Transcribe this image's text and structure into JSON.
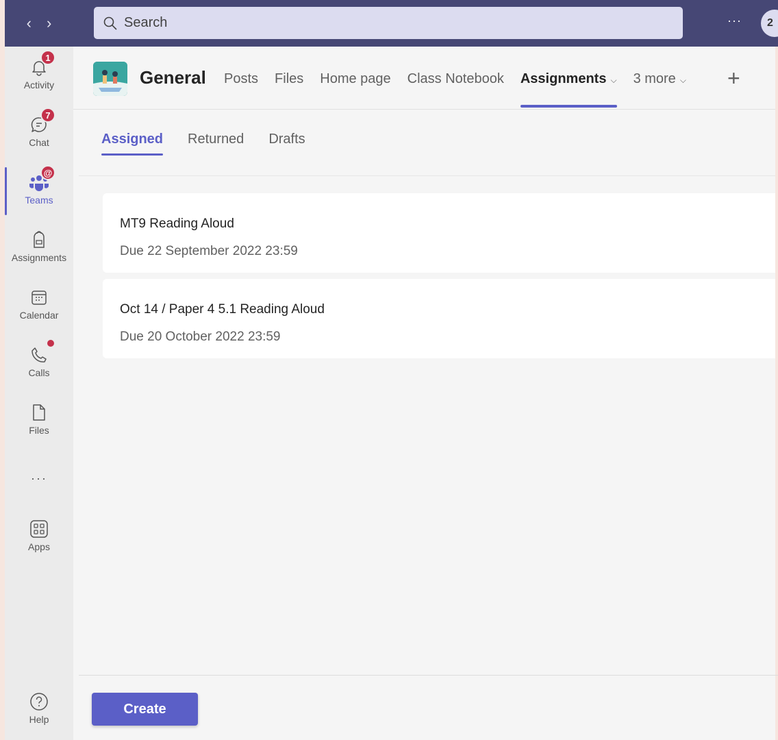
{
  "topbar": {
    "search_placeholder": "Search",
    "more_label": "···",
    "avatar_initials": "2"
  },
  "rail": {
    "items": [
      {
        "label": "Activity",
        "badge": "1"
      },
      {
        "label": "Chat",
        "badge": "7"
      },
      {
        "label": "Teams",
        "badge": "@"
      },
      {
        "label": "Assignments"
      },
      {
        "label": "Calendar"
      },
      {
        "label": "Calls"
      },
      {
        "label": "Files"
      },
      {
        "label": "Apps"
      },
      {
        "label": "Help"
      }
    ],
    "more_label": "···"
  },
  "channel": {
    "name": "General",
    "tabs": [
      {
        "label": "Posts"
      },
      {
        "label": "Files"
      },
      {
        "label": "Home page"
      },
      {
        "label": "Class Notebook"
      },
      {
        "label": "Assignments"
      },
      {
        "label": "3 more"
      }
    ]
  },
  "subtabs": [
    {
      "label": "Assigned"
    },
    {
      "label": "Returned"
    },
    {
      "label": "Drafts"
    }
  ],
  "assignments": [
    {
      "title": "MT9 Reading Aloud",
      "due": "Due 22 September 2022 23:59"
    },
    {
      "title": "Oct 14 / Paper 4 5.1 Reading Aloud",
      "due": "Due 20 October 2022 23:59"
    }
  ],
  "actions": {
    "create_label": "Create"
  },
  "colors": {
    "brand": "#5b5fc7",
    "topbar": "#464775",
    "badge": "#c4314b"
  }
}
